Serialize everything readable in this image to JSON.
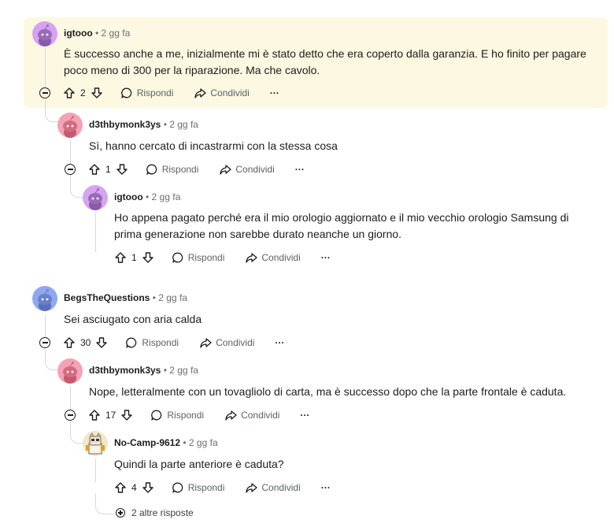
{
  "comments": [
    {
      "user": "igtooo",
      "time": "2 gg fa",
      "text": "È successo anche a me, inizialmente mi è stato detto che era coperto dalla garanzia. E ho finito per pagare poco meno di 300 per la riparazione. Ma che cavolo.",
      "votes": "2",
      "avatar_color": "#d6a3f0"
    },
    {
      "user": "d3thbymonk3ys",
      "time": "2 gg fa",
      "text": "Sì, hanno cercato di incastrarmi con la stessa cosa",
      "votes": "1",
      "avatar_color": "#f3a3b5"
    },
    {
      "user": "igtooo",
      "time": "2 gg fa",
      "text": "Ho appena pagato perché era il mio orologio aggiornato e il mio vecchio orologio Samsung di prima generazione non sarebbe durato neanche un giorno.",
      "votes": "1",
      "avatar_color": "#d6a3f0"
    },
    {
      "user": "BegsTheQuestions",
      "time": "2 gg fa",
      "text": "Sei asciugato con aria calda",
      "votes": "30",
      "avatar_color": "#8fa8ef"
    },
    {
      "user": "d3thbymonk3ys",
      "time": "2 gg fa",
      "text": "Nope, letteralmente con un tovagliolo di carta, ma è successo dopo che la parte frontale è caduta.",
      "votes": "17",
      "avatar_color": "#f3a3b5"
    },
    {
      "user": "No-Camp-9612",
      "time": "2 gg fa",
      "text": "Quindi la parte anteriore è caduta?",
      "votes": "4",
      "avatar_color": "#f2e7c9"
    }
  ],
  "labels": {
    "reply": "Rispondi",
    "share": "Condividi",
    "separator": "•",
    "more_menu": "···"
  },
  "more_replies": "2 altre risposte",
  "icons": {
    "upvote": "arrow-up-icon",
    "downvote": "arrow-down-icon",
    "reply": "speech-bubble-icon",
    "share": "share-arrow-icon",
    "collapse": "minus-circle-icon",
    "expand": "plus-circle-icon"
  },
  "colors": {
    "highlight": "#fdf8e1",
    "muted": "#5c6266",
    "thread_line": "#d6d8da"
  }
}
